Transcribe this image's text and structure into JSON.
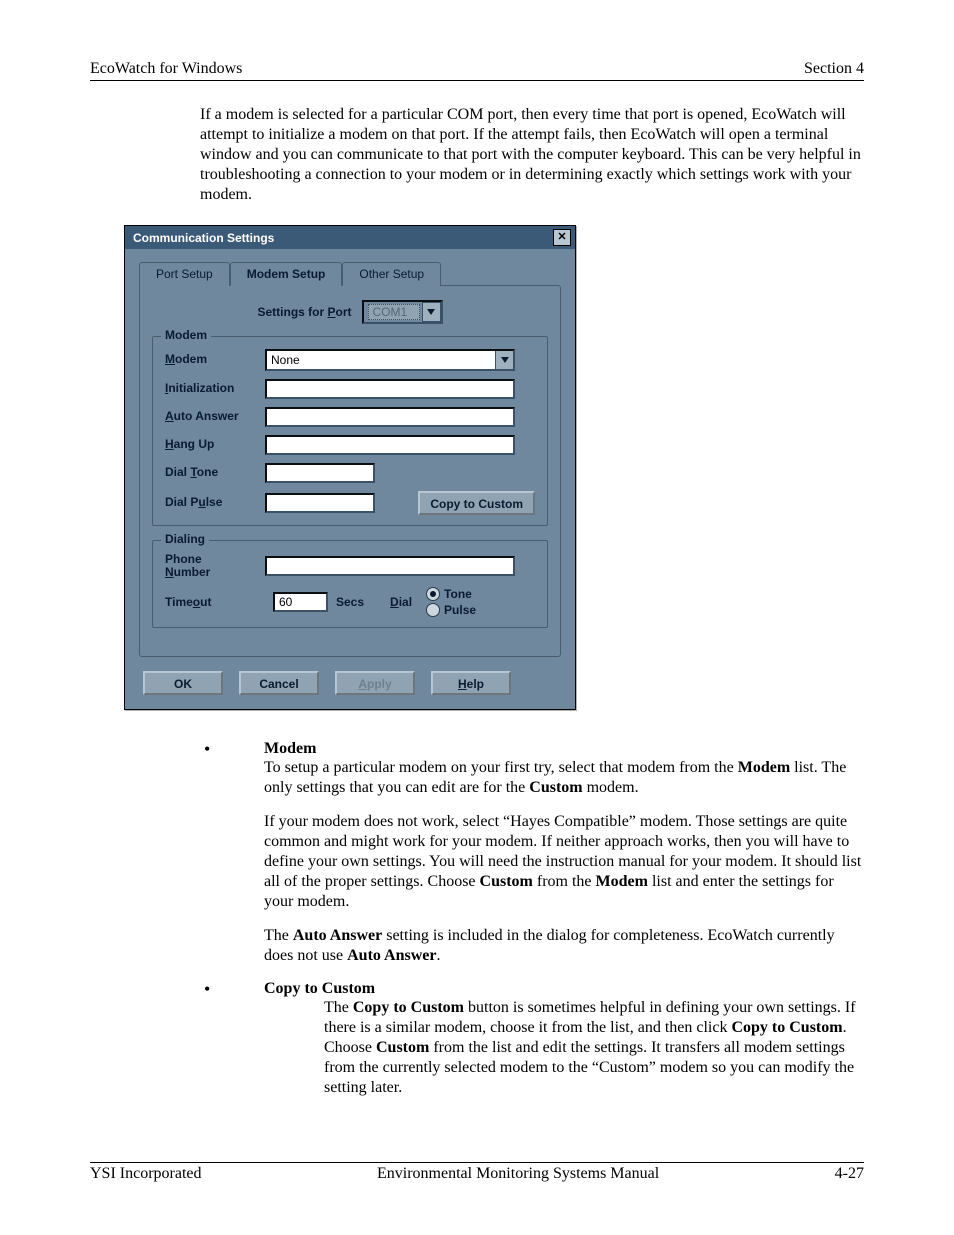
{
  "header": {
    "left": "EcoWatch for Windows",
    "right": "Section 4"
  },
  "intro_paragraph": "If a modem is selected for a particular COM port, then every time that port is opened, EcoWatch will attempt to initialize a modem on that port. If the attempt fails, then EcoWatch will open a terminal window and you can communicate to that port with the computer keyboard.  This can be very helpful in troubleshooting a connection to your modem or in determining exactly which settings work with your modem.",
  "dialog": {
    "title": "Communication Settings",
    "tabs": {
      "port": "Port Setup",
      "modem": "Modem Setup",
      "other": "Other Setup"
    },
    "settings_for_port_label_pre": "Settings for ",
    "settings_for_port_label_u": "P",
    "settings_for_port_label_post": "ort",
    "port_value": "COM1",
    "group_modem": {
      "title": "Modem",
      "labels": {
        "modem_u": "M",
        "modem_rest": "odem",
        "init_u": "I",
        "init_rest": "nitialization",
        "auto_u": "A",
        "auto_rest": "uto Answer",
        "hang_u": "H",
        "hang_rest": "ang Up",
        "tone_pre": "Dial ",
        "tone_u": "T",
        "tone_rest": "one",
        "pulse_pre": "Dial P",
        "pulse_u": "u",
        "pulse_rest": "lse"
      },
      "modem_value": "None",
      "initialization_value": "",
      "auto_answer_value": "",
      "hang_up_value": "",
      "dial_tone_value": "",
      "dial_pulse_value": "",
      "copy_btn": "Copy to Custom"
    },
    "group_dialing": {
      "title": "Dialing",
      "phone_line1": "Phone",
      "phone_u": "N",
      "phone_rest": "umber",
      "phone_value": "",
      "timeout_pre": "Time",
      "timeout_u": "o",
      "timeout_post": "ut",
      "timeout_value": "60",
      "secs": "Secs",
      "dial_u": "D",
      "dial_rest": "ial",
      "tone_radio": "Tone",
      "pulse_radio": "Pulse"
    },
    "buttons": {
      "ok": "OK",
      "cancel": "Cancel",
      "apply_u": "A",
      "apply_rest": "pply",
      "help_u": "H",
      "help_rest": "elp"
    }
  },
  "bullets": {
    "modem": {
      "title": "Modem",
      "p1_a": "To setup a particular modem on your first try, select that modem from the ",
      "p1_b": "Modem",
      "p1_c": " list.  The only settings that you can edit are for the ",
      "p1_d": "Custom",
      "p1_e": " modem.",
      "p2_a": "If your modem does not work, select “Hayes Compatible” modem.  Those settings are quite common and might work for your modem.  If neither approach works, then you will have to define your own settings.  You will need the instruction manual for your modem.  It should list all of the proper settings.  Choose ",
      "p2_b": "Custom",
      "p2_c": " from the ",
      "p2_d": "Modem",
      "p2_e": " list and enter the settings for your modem.",
      "p3_a": "The ",
      "p3_b": "Auto Answer",
      "p3_c": " setting is included in the dialog for completeness.  EcoWatch currently does not use ",
      "p3_d": "Auto Answer",
      "p3_e": "."
    },
    "copy": {
      "title": "Copy to Custom",
      "p_a": "The ",
      "p_b": "Copy to Custom",
      "p_c": " button is sometimes helpful in defining your own settings.  If there is a similar modem, choose it from the list, and then click ",
      "p_d": "Copy to Custom",
      "p_e": ".  Choose ",
      "p_f": "Custom",
      "p_g": " from the list and edit the settings. It transfers all modem settings from the currently selected modem to the “Custom” modem so you can modify the setting later."
    }
  },
  "footer": {
    "left": "YSI Incorporated",
    "center": "Environmental Monitoring Systems Manual",
    "right": "4-27"
  }
}
